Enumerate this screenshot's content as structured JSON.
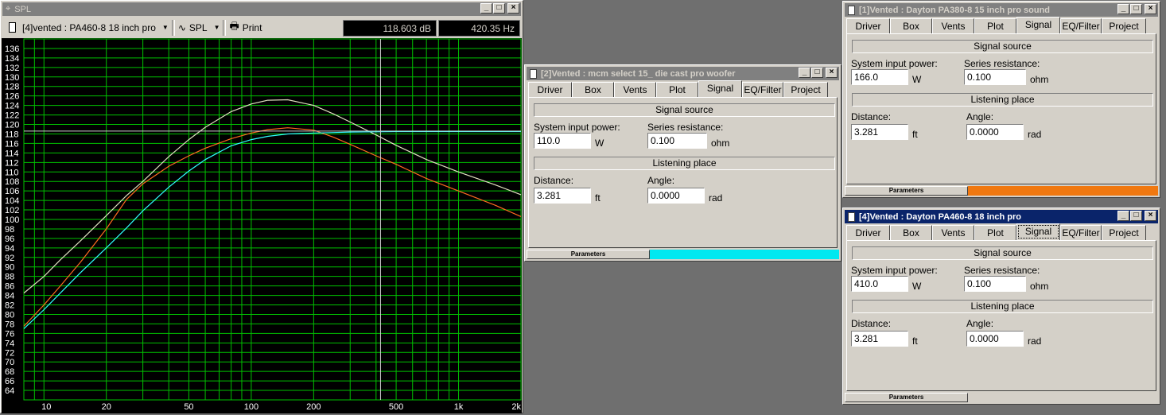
{
  "spl_window": {
    "title": "SPL",
    "driver_select": "[4]vented : PA460-8 18 inch pro",
    "plot_select": "SPL",
    "print_label": "Print",
    "readout_db": "118.603 dB",
    "readout_hz": "420.35 Hz",
    "buttons": [
      "_",
      "□",
      "×"
    ]
  },
  "chart_data": {
    "type": "line",
    "xscale": "log",
    "xlim": [
      8,
      2000
    ],
    "ylim": [
      62,
      138
    ],
    "y_ticks": [
      64,
      66,
      68,
      70,
      72,
      74,
      76,
      78,
      80,
      82,
      84,
      86,
      88,
      90,
      92,
      94,
      96,
      98,
      100,
      102,
      104,
      106,
      108,
      110,
      112,
      114,
      116,
      118,
      120,
      122,
      124,
      126,
      128,
      130,
      132,
      134,
      136
    ],
    "x_tick_labels": [
      {
        "v": 10,
        "t": "10"
      },
      {
        "v": 20,
        "t": "20"
      },
      {
        "v": 50,
        "t": "50"
      },
      {
        "v": 100,
        "t": "100"
      },
      {
        "v": 200,
        "t": "200"
      },
      {
        "v": 500,
        "t": "500"
      },
      {
        "v": 1000,
        "t": "1k"
      },
      {
        "v": 2000,
        "t": "2k"
      }
    ],
    "cursor": {
      "x": 420.35,
      "y": 118.603
    },
    "grid": true,
    "colors": {
      "bg": "#000000",
      "grid": "#00c000",
      "cursor": "#d0d0d0"
    },
    "series": [
      {
        "color": "#e0e0c0",
        "x": [
          8,
          10,
          12,
          15,
          20,
          25,
          30,
          40,
          50,
          60,
          80,
          100,
          120,
          150,
          200,
          250,
          300,
          400,
          500,
          700,
          1000,
          1500,
          2000
        ],
        "y": [
          84.5,
          88,
          91.5,
          95.5,
          100.8,
          105,
          108,
          113.2,
          116.8,
          119.4,
          122.7,
          124.3,
          125.1,
          125.2,
          124,
          122.2,
          120.5,
          117.8,
          115.6,
          112.6,
          110,
          107.3,
          105.2
        ]
      },
      {
        "color": "#ff6a20",
        "x": [
          8,
          10,
          12,
          15,
          20,
          25,
          30,
          40,
          50,
          60,
          80,
          100,
          120,
          150,
          200,
          250,
          300,
          400,
          500,
          700,
          1000,
          1500,
          2000
        ],
        "y": [
          77.5,
          82,
          86,
          91,
          98,
          104.2,
          107.5,
          111.2,
          113.4,
          115,
          117,
          118.2,
          118.9,
          119.3,
          118.8,
          117.3,
          115.8,
          113.4,
          111.6,
          108.6,
          106,
          103,
          100.6
        ]
      },
      {
        "color": "#30ffff",
        "x": [
          8,
          10,
          12,
          15,
          20,
          25,
          30,
          40,
          50,
          60,
          80,
          100,
          120,
          150,
          200,
          250,
          300,
          400,
          500,
          700,
          1000,
          1500,
          2000
        ],
        "y": [
          77,
          81,
          84.5,
          88.8,
          94,
          98.2,
          101.8,
          106.8,
          110.2,
          112.6,
          115.5,
          116.8,
          117.5,
          118,
          118.2,
          118.3,
          118.4,
          118.45,
          118.5,
          118.5,
          118.5,
          118.5,
          118.5
        ]
      }
    ]
  },
  "win2": {
    "title": "[2]Vented : mcm select 15_ die cast pro woofer",
    "tabs": [
      "Driver",
      "Box",
      "Vents",
      "Plot",
      "Signal",
      "EQ/Filter",
      "Project"
    ],
    "signal_source": "Signal source",
    "power_label": "System input power:",
    "power_value": "110.0",
    "power_unit": "W",
    "res_label": "Series resistance:",
    "res_value": "0.100",
    "res_unit": "ohm",
    "listening": "Listening place",
    "dist_label": "Distance:",
    "dist_value": "3.281",
    "dist_unit": "ft",
    "angle_label": "Angle:",
    "angle_value": "0.0000",
    "angle_unit": "rad",
    "status_label": "Parameters",
    "status_color": "#00e8f0"
  },
  "win1": {
    "title": "[1]Vented : Dayton PA380-8 15 inch pro sound",
    "tabs": [
      "Driver",
      "Box",
      "Vents",
      "Plot",
      "Signal",
      "EQ/Filter",
      "Project"
    ],
    "signal_source": "Signal source",
    "power_label": "System input power:",
    "power_value": "166.0",
    "power_unit": "W",
    "res_label": "Series resistance:",
    "res_value": "0.100",
    "res_unit": "ohm",
    "listening": "Listening place",
    "dist_label": "Distance:",
    "dist_value": "3.281",
    "dist_unit": "ft",
    "angle_label": "Angle:",
    "angle_value": "0.0000",
    "angle_unit": "rad",
    "status_label": "Parameters",
    "status_color": "#f07810"
  },
  "win4": {
    "title": "[4]Vented : Dayton PA460-8 18 inch pro",
    "tabs": [
      "Driver",
      "Box",
      "Vents",
      "Plot",
      "Signal",
      "EQ/Filter",
      "Project"
    ],
    "signal_source": "Signal source",
    "power_label": "System input power:",
    "power_value": "410.0",
    "power_unit": "W",
    "res_label": "Series resistance:",
    "res_value": "0.100",
    "res_unit": "ohm",
    "listening": "Listening place",
    "dist_label": "Distance:",
    "dist_value": "3.281",
    "dist_unit": "ft",
    "angle_label": "Angle:",
    "angle_value": "0.0000",
    "angle_unit": "rad",
    "status_label": "Parameters",
    "status_color": "#d4d0c8"
  }
}
